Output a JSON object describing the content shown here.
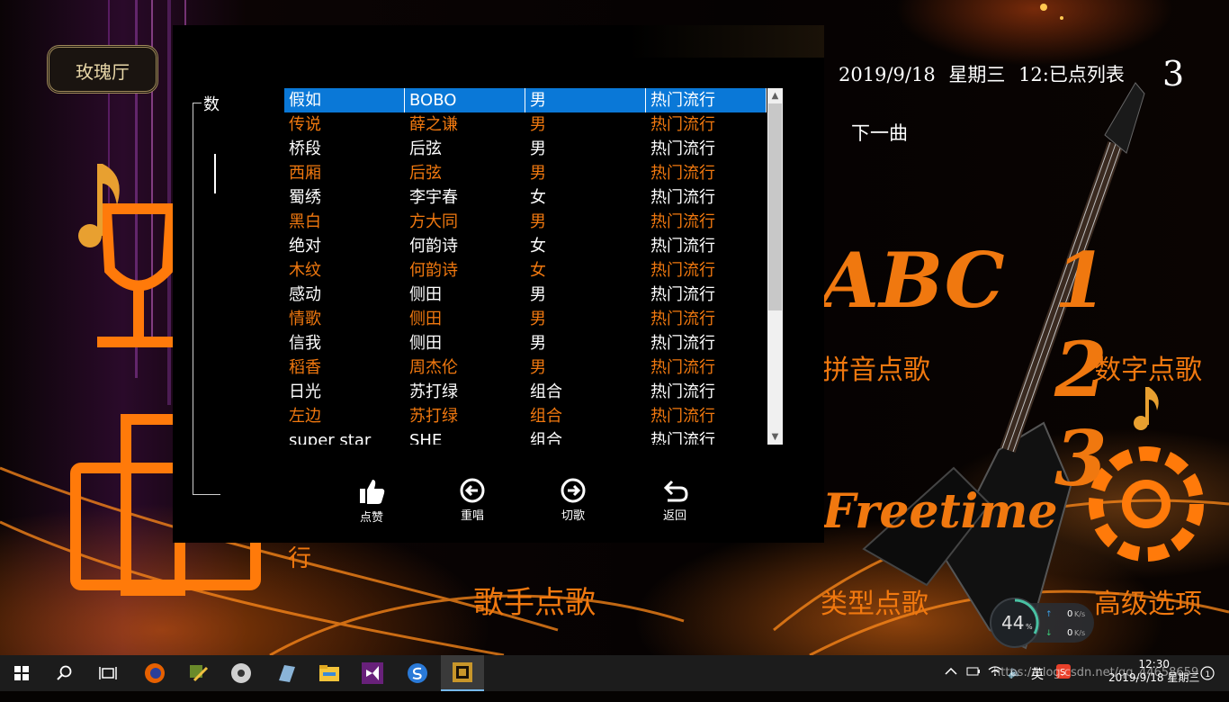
{
  "app": {
    "logo_text": "玫瑰厅",
    "date_text": "2019/9/18",
    "weekday_text": "星期三",
    "time_text": "12:",
    "queue_label": "已点列表",
    "queue_count": "3",
    "next_song_label": "下一曲",
    "menu": {
      "pinyin": "拼音点歌",
      "number": "数字点歌",
      "singer": "歌手点歌",
      "category": "类型点歌",
      "advanced": "高级选项",
      "left_partial": "行",
      "abc_art": "ABC",
      "num_art": "1 2 3",
      "freetime_art": "Freetime"
    }
  },
  "dialog": {
    "group_label": "数",
    "songs": [
      {
        "title": "假如",
        "singer": "BOBO",
        "gender": "男",
        "genre": "热门流行",
        "style": "sel"
      },
      {
        "title": "传说",
        "singer": "薛之谦",
        "gender": "男",
        "genre": "热门流行",
        "style": "orange"
      },
      {
        "title": "桥段",
        "singer": "后弦",
        "gender": "男",
        "genre": "热门流行",
        "style": "white"
      },
      {
        "title": "西厢",
        "singer": "后弦",
        "gender": "男",
        "genre": "热门流行",
        "style": "orange"
      },
      {
        "title": "蜀绣",
        "singer": "李宇春",
        "gender": "女",
        "genre": "热门流行",
        "style": "white"
      },
      {
        "title": "黑白",
        "singer": "方大同",
        "gender": "男",
        "genre": "热门流行",
        "style": "orange"
      },
      {
        "title": "绝对",
        "singer": "何韵诗",
        "gender": "女",
        "genre": "热门流行",
        "style": "white"
      },
      {
        "title": "木纹",
        "singer": "何韵诗",
        "gender": "女",
        "genre": "热门流行",
        "style": "orange"
      },
      {
        "title": "感动",
        "singer": "侧田",
        "gender": "男",
        "genre": "热门流行",
        "style": "white"
      },
      {
        "title": "情歌",
        "singer": "侧田",
        "gender": "男",
        "genre": "热门流行",
        "style": "orange"
      },
      {
        "title": "信我",
        "singer": "侧田",
        "gender": "男",
        "genre": "热门流行",
        "style": "white"
      },
      {
        "title": "稻香",
        "singer": "周杰伦",
        "gender": "男",
        "genre": "热门流行",
        "style": "orange"
      },
      {
        "title": "日光",
        "singer": "苏打绿",
        "gender": "组合",
        "genre": "热门流行",
        "style": "white"
      },
      {
        "title": "左边",
        "singer": "苏打绿",
        "gender": "组合",
        "genre": "热门流行",
        "style": "orange"
      },
      {
        "title": "super star",
        "singer": "SHE",
        "gender": "组合",
        "genre": "热门流行",
        "style": "white"
      }
    ],
    "controls": {
      "like": "点赞",
      "replay": "重唱",
      "skip": "切歌",
      "back": "返回"
    }
  },
  "netmon": {
    "cpu_percent": "44",
    "percent_sign": "%",
    "up_speed": "0",
    "down_speed": "0",
    "speed_unit": "K/s"
  },
  "taskbar": {
    "clock_time": "12:30",
    "clock_date": "2019/9/18 星期三",
    "ime": "英",
    "watermark": "https://blog.csdn.net/qq_44658659",
    "icons": [
      "windows-start-icon",
      "search-icon",
      "task-view-icon",
      "firefox-icon",
      "paint-tool-icon",
      "media-player-icon",
      "notepad-icon",
      "file-explorer-icon",
      "visual-studio-icon",
      "sogou-browser-icon",
      "ktv-app-icon"
    ]
  },
  "colors": {
    "accent_orange": "#f0780f",
    "selection_blue": "#0a78d7",
    "taskbar": "#1c1c1c"
  }
}
